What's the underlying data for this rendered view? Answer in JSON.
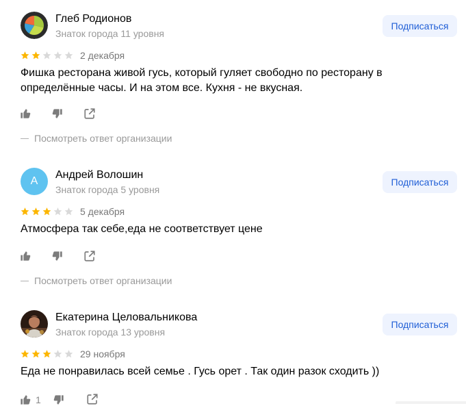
{
  "reviews": [
    {
      "author": "Глеб Родионов",
      "level": "Знаток города 11 уровня",
      "avatar_kind": "pie-chart-avatar",
      "subscribe_label": "Подписаться",
      "rating": 2,
      "max_rating": 5,
      "date": "2 декабря",
      "text": "Фишка ресторана живой гусь, который гуляет свободно по ресторану в определённые часы. И на этом все. Кухня - не вкусная.",
      "likes": "",
      "org_response_label": "Посмотреть ответ организации"
    },
    {
      "author": "Андрей Волошин",
      "level": "Знаток города 5 уровня",
      "avatar_letter": "А",
      "subscribe_label": "Подписаться",
      "rating": 3,
      "max_rating": 5,
      "date": "5 декабря",
      "text": "Атмосфера так себе,еда не соответствует цене",
      "likes": "",
      "org_response_label": "Посмотреть ответ организации"
    },
    {
      "author": "Екатерина Целовальникова",
      "level": "Знаток города 13 уровня",
      "avatar_kind": "photo-avatar",
      "subscribe_label": "Подписаться",
      "rating": 3,
      "max_rating": 5,
      "date": "29 ноября",
      "text": "Еда не понравилась всей семье . Гусь орет . Так один разок сходить ))",
      "likes": "1"
    }
  ],
  "colors": {
    "star_filled": "#fcb600",
    "star_empty": "#d9d9d9",
    "subscribe_bg": "#eef3fe",
    "subscribe_text": "#1f5ed6",
    "avatar_letter_bg": "#5fc3f0",
    "muted_text": "#999999",
    "icon": "#7c7c7c"
  }
}
